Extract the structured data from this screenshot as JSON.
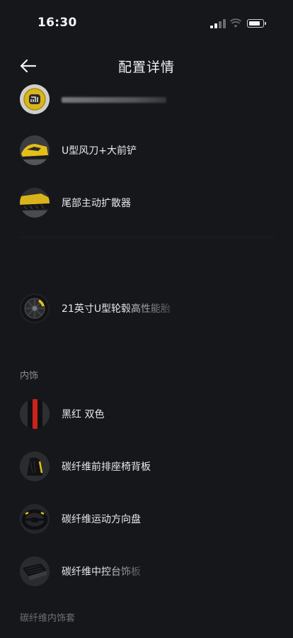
{
  "status_bar": {
    "time": "16:30",
    "battery_level": 0.85
  },
  "header": {
    "title": "配置详情",
    "back_icon": "arrow-left-icon"
  },
  "exterior_items": [
    {
      "label": "",
      "thumbnail": "xiaomi-logo-badge"
    },
    {
      "label": "U型风刀+大前铲",
      "thumbnail": "yellow-car-front"
    },
    {
      "label": "尾部主动扩散器",
      "thumbnail": "car-rear-diffuser"
    },
    {
      "label": "21英寸U型轮毂高性能胎",
      "thumbnail": "wheel-yellow-caliper"
    }
  ],
  "interior_section": {
    "title": "内饰",
    "items": [
      {
        "label": "黑红 双色",
        "thumbnail": "black-red-swatch"
      },
      {
        "label": "碳纤维前排座椅背板",
        "thumbnail": "carbon-seat-back"
      },
      {
        "label": "碳纤维运动方向盘",
        "thumbnail": "carbon-steering-wheel"
      },
      {
        "label": "碳纤维中控台饰板",
        "thumbnail": "carbon-center-console"
      }
    ]
  },
  "next_section": {
    "title": "碳纤维内饰套"
  },
  "colors": {
    "background": "#16171b",
    "accent_yellow": "#e8c21c",
    "accent_red": "#c8231e"
  }
}
